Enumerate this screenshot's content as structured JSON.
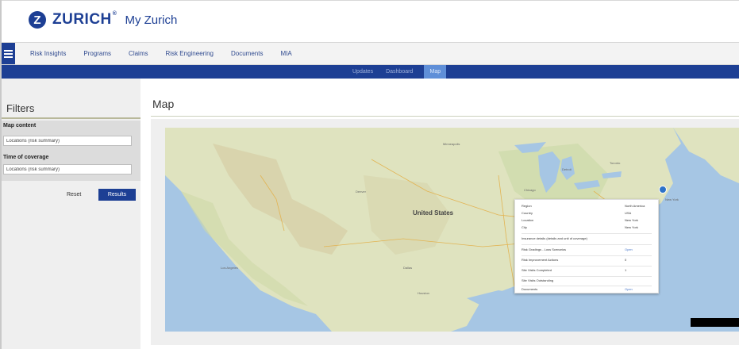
{
  "header": {
    "logo_text": "ZURICH",
    "logo_mark": "Z",
    "registered": "®",
    "app_name": "My Zurich",
    "brand_color": "#1d3f94"
  },
  "nav": {
    "items": [
      {
        "label": "Risk Insights"
      },
      {
        "label": "Programs"
      },
      {
        "label": "Claims"
      },
      {
        "label": "Risk Engineering"
      },
      {
        "label": "Documents"
      },
      {
        "label": "MIA"
      }
    ]
  },
  "subnav": {
    "items": [
      {
        "label": "Updates",
        "active": false
      },
      {
        "label": "Dashboard",
        "active": false
      },
      {
        "label": "Map",
        "active": true
      }
    ]
  },
  "filters": {
    "title": "Filters",
    "groups": [
      {
        "label": "Map content",
        "value": "Locations (risk summary)"
      },
      {
        "label": "Time of coverage",
        "value": "Locations (risk summary)"
      }
    ],
    "reset_label": "Reset",
    "results_label": "Results"
  },
  "main": {
    "title": "Map",
    "map": {
      "country_label": "United States",
      "labels": [
        {
          "text": "Minneapolis"
        },
        {
          "text": "Chicago"
        },
        {
          "text": "Denver"
        },
        {
          "text": "Los Angeles"
        },
        {
          "text": "Dallas"
        },
        {
          "text": "Houston"
        },
        {
          "text": "Detroit"
        },
        {
          "text": "Toronto"
        },
        {
          "text": "New York"
        }
      ]
    },
    "popup": {
      "rows": [
        {
          "key": "Region",
          "value": "North America"
        },
        {
          "key": "Country",
          "value": "USA"
        },
        {
          "key": "Location",
          "value": "New York"
        },
        {
          "key": "City",
          "value": "New York"
        },
        {
          "key": "Insurance details (details and unit of coverage)",
          "value": ""
        },
        {
          "key": "Risk Gradings - Loss Scenarios",
          "value": "Open"
        },
        {
          "key": "Risk Improvement Actions",
          "value": "0"
        },
        {
          "key": "Site Visits Completed",
          "value": "1"
        },
        {
          "key": "Site Visits Outstanding",
          "value": ""
        },
        {
          "key": "Documents",
          "value": "Open"
        }
      ]
    }
  }
}
